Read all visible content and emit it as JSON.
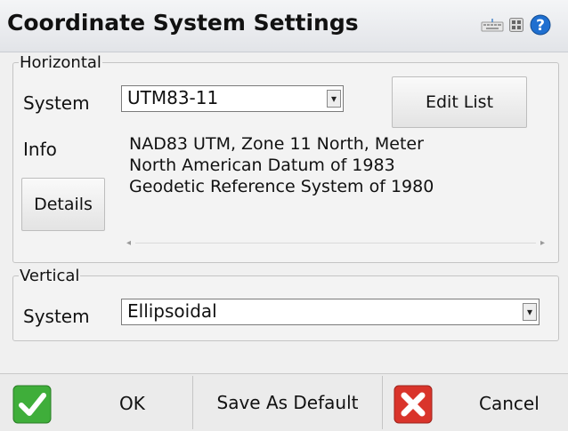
{
  "title": "Coordinate System Settings",
  "horizontal": {
    "legend": "Horizontal",
    "system_label": "System",
    "system_value": "UTM83-11",
    "edit_list": "Edit List",
    "info_label": "Info",
    "info_lines": [
      "NAD83 UTM, Zone 11 North, Meter",
      "North American Datum of 1983",
      "Geodetic Reference System of 1980"
    ],
    "details": "Details"
  },
  "vertical": {
    "legend": "Vertical",
    "system_label": "System",
    "system_value": "Ellipsoidal"
  },
  "footer": {
    "ok": "OK",
    "save_default": "Save As Default",
    "cancel": "Cancel"
  },
  "icons": {
    "keyboard": "keyboard-icon",
    "grid": "grid-icon",
    "help": "help-icon",
    "ok": "check-icon",
    "cancel": "x-icon"
  },
  "colors": {
    "help_blue": "#1f6fd0",
    "ok_green": "#3fae3a",
    "cancel_red": "#d9342b"
  }
}
